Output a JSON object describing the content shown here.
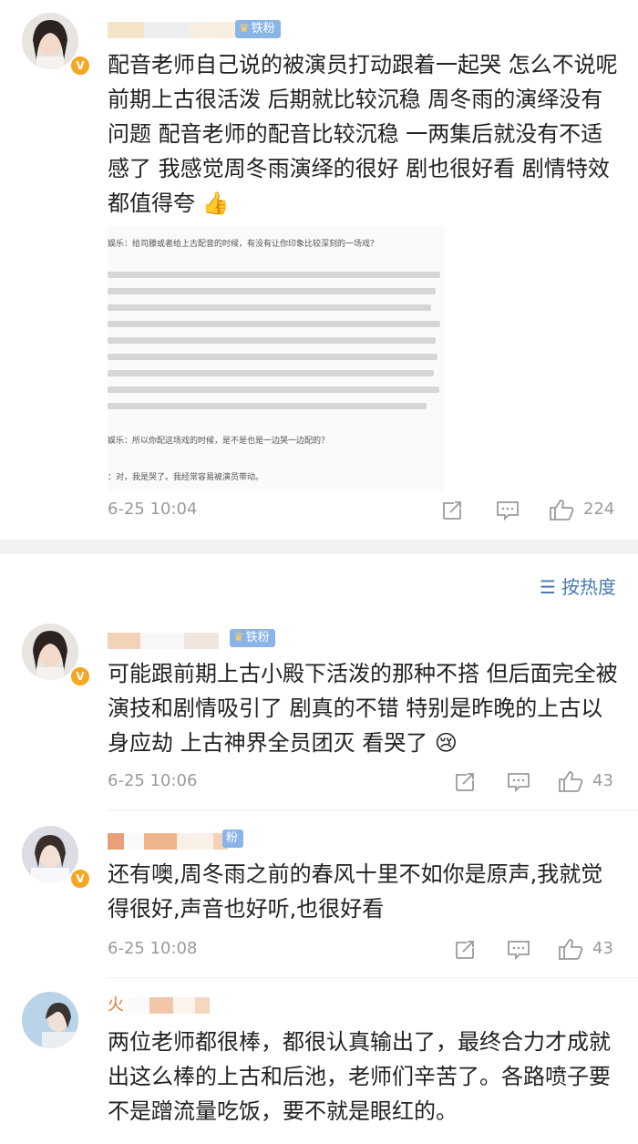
{
  "comments": [
    {
      "text": "配音老师自己说的被演员打动跟着一起哭 怎么不说呢 前期上古很活泼 后期就比较沉稳 周冬雨的演绎没有问题 配音老师的配音比较沉稳 一两集后就没有不适感了 我感觉周冬雨演绎的很好 剧也很好看 剧情特效都值得夸",
      "emoji": "👍",
      "badge": "铁粉",
      "time": "6-25 10:04",
      "likes": "224"
    },
    {
      "text": "可能跟前期上古小殿下活泼的那种不搭 但后面完全被演技和剧情吸引了 剧真的不错 特别是昨晚的上古以身应劫 上古神界全员团灭 看哭了",
      "emoji": "😢",
      "badge": "铁粉",
      "time": "6-25 10:06",
      "likes": "43"
    },
    {
      "text": "还有噢,周冬雨之前的春风十里不如你是原声,我就觉得很好,声音也好听,也很好看",
      "badge": "粉",
      "time": "6-25 10:08",
      "likes": "43"
    },
    {
      "text": "两位老师都很棒，都很认真输出了，最终合力才成就出这么棒的上古和后池，老师们辛苦了。各路喷子要不是蹭流量吃饭，要不就是眼红的。",
      "name_fragment": "火"
    }
  ],
  "sort_label": "按热度",
  "embedded_doc": {
    "q1": "娱乐：给司滕或者给上古配音的时候，有没有让你印象比较深刻的一场戏？",
    "q2": "娱乐：所以你配这场戏的时候，是不是也是一边哭一边配的？",
    "a2": "：对，我是哭了。我经常容易被演员带动。"
  },
  "icons": [
    "repost-icon",
    "comment-icon",
    "like-icon",
    "sort-icon"
  ],
  "colors": {
    "time": "#9a9a9a",
    "sort": "#4a7ab0",
    "fan_badge": "#8ab4e8",
    "verified": "#f5a623"
  }
}
